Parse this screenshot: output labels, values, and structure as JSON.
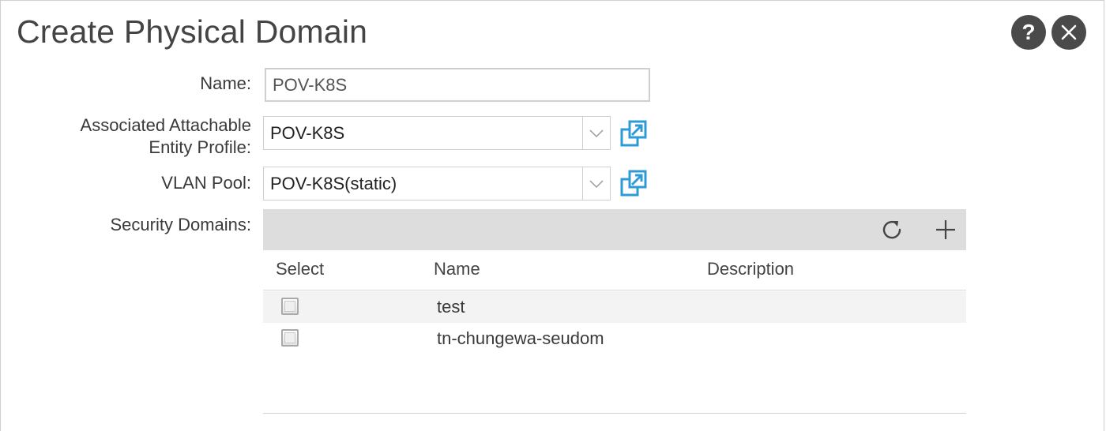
{
  "dialog": {
    "title": "Create Physical Domain",
    "help_icon": "question-mark-icon",
    "close_icon": "close-icon"
  },
  "form": {
    "name_label": "Name:",
    "name_value": "POV-K8S",
    "aaep_label_line1": "Associated Attachable",
    "aaep_label_line2": "Entity Profile:",
    "aaep_value": "POV-K8S",
    "vlan_label": "VLAN Pool:",
    "vlan_value": "POV-K8S(static)",
    "open_icon": "external-open-icon",
    "dropdown_icon": "chevron-down-icon"
  },
  "security_domains": {
    "label": "Security Domains:",
    "toolbar_icons": [
      "refresh-icon",
      "plus-icon"
    ],
    "columns": [
      "Select",
      "Name",
      "Description"
    ],
    "rows": [
      {
        "name": "test",
        "description": "",
        "selected": false
      },
      {
        "name": "tn-chungewa-seudom",
        "description": "",
        "selected": false
      }
    ]
  },
  "colors": {
    "title_text": "#444444",
    "round_button_bg": "#4a4a4a",
    "accent_blue": "#2e9bd6",
    "toolbar_bg": "#dddddd",
    "row_alt_bg": "#f3f3f3"
  }
}
